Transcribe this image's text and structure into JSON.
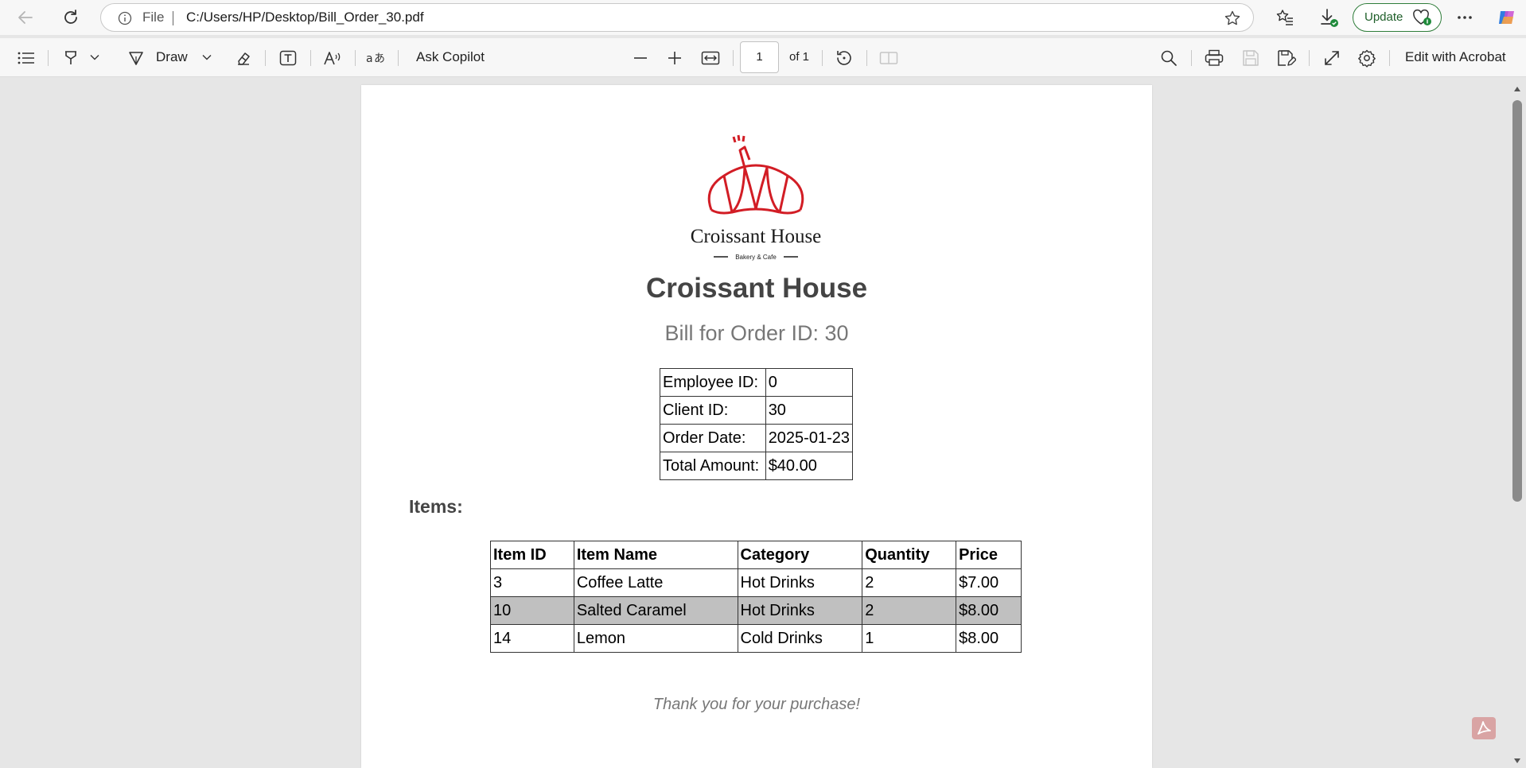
{
  "browser": {
    "url_scheme_label": "File",
    "url_path": "C:/Users/HP/Desktop/Bill_Order_30.pdf",
    "update_label": "Update"
  },
  "pdf_toolbar": {
    "draw_label": "Draw",
    "ask_copilot_label": "Ask Copilot",
    "page_number": "1",
    "page_total_label": "of 1",
    "edit_acrobat_label": "Edit with Acrobat"
  },
  "document": {
    "logo": {
      "brand": "Croissant House",
      "tagline": "Bakery & Cafe",
      "accent": "#d21d25"
    },
    "title": "Croissant House",
    "subtitle": "Bill for Order ID: 30",
    "info": [
      {
        "label": "Employee ID:",
        "value": "0"
      },
      {
        "label": "Client ID:",
        "value": "30"
      },
      {
        "label": "Order Date:",
        "value": "2025-01-23"
      },
      {
        "label": "Total Amount:",
        "value": "$40.00"
      }
    ],
    "items_heading": "Items:",
    "items_columns": [
      "Item ID",
      "Item Name",
      "Category",
      "Quantity",
      "Price"
    ],
    "items_rows": [
      [
        "3",
        "Coffee Latte",
        "Hot Drinks",
        "2",
        "$7.00"
      ],
      [
        "10",
        "Salted Caramel",
        "Hot Drinks",
        "2",
        "$8.00"
      ],
      [
        "14",
        "Lemon",
        "Cold Drinks",
        "1",
        "$8.00"
      ]
    ],
    "thank_you": "Thank you for your purchase!"
  }
}
